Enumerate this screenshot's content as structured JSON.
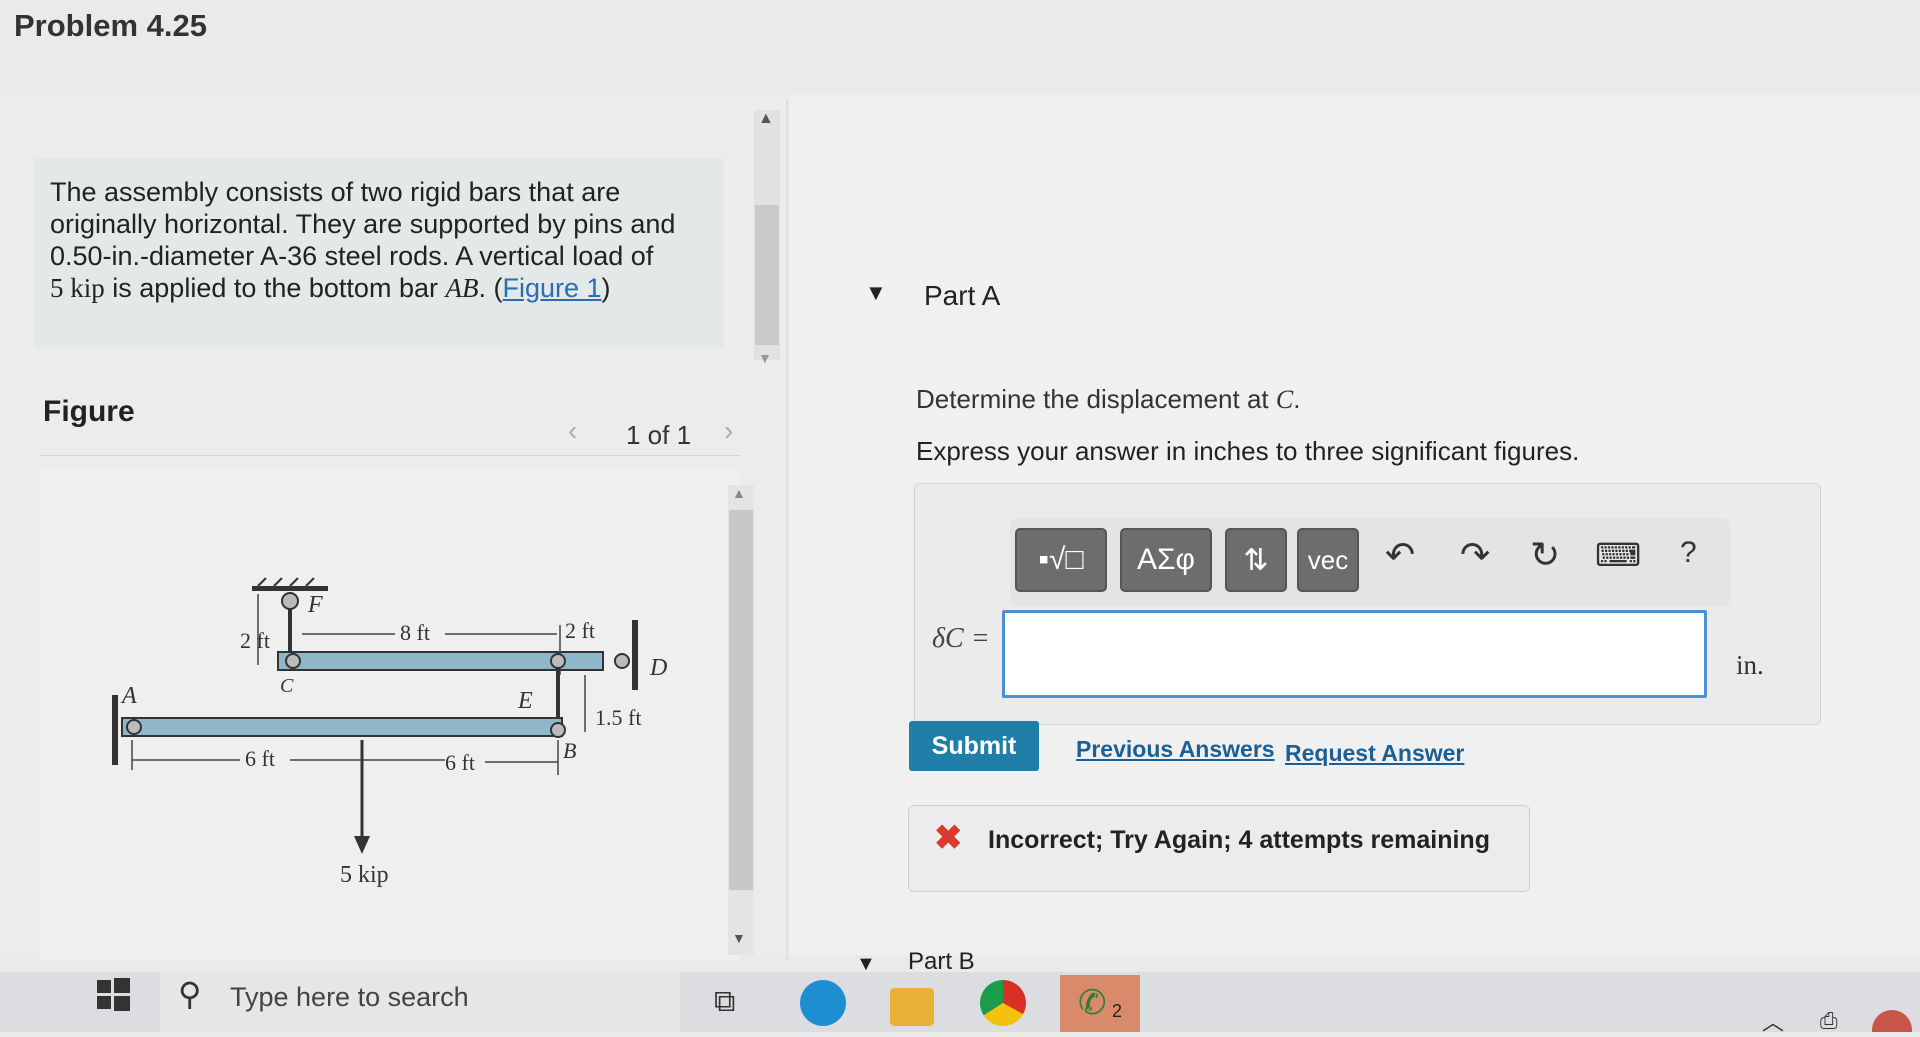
{
  "header": {
    "problem_title": "Problem 4.25"
  },
  "description": {
    "line1": "The assembly consists of two rigid bars that are",
    "line2": "originally horizontal. They are supported by pins and",
    "line3": "0.50-in.-diameter A-36 steel rods. A vertical load of",
    "line4_pre": "5 kip",
    "line4_mid": " is applied to the bottom bar ",
    "line4_math": "AB",
    "line4_post": ". (",
    "figure_link": "Figure 1",
    "line4_end": ")"
  },
  "figure": {
    "heading": "Figure",
    "pager": "1 of 1",
    "labels": {
      "A": "A",
      "B": "B",
      "C": "C",
      "D": "D",
      "E": "E",
      "F": "F",
      "dim_2ft_left": "2 ft",
      "dim_8ft": "8 ft",
      "dim_2ft_right": "2 ft",
      "dim_1_5ft": "1.5 ft",
      "dim_6ft_a": "6 ft",
      "dim_6ft_b": "6 ft",
      "load": "5 kip"
    }
  },
  "partA": {
    "title": "Part A",
    "question_pre": "Determine the displacement at ",
    "question_math": "C",
    "question_post": ".",
    "instruction": "Express your answer in inches to three significant figures.",
    "toolbar": {
      "greek_label": "ΑΣφ",
      "vec_label": "vec",
      "help_label": "?"
    },
    "answer_label": "δC =",
    "answer_value": "",
    "unit": "in.",
    "submit_label": "Submit",
    "previous_answers_label": "Previous Answers",
    "request_answer_label": "Request Answer",
    "feedback_text": "Incorrect; Try Again; 4 attempts remaining"
  },
  "partB": {
    "title": "Part B"
  },
  "taskbar": {
    "search_placeholder": "Type here to search",
    "whatsapp_badge": "2"
  },
  "colors": {
    "accent": "#1f7fa8",
    "link": "#1a5f95",
    "error": "#d83a2e",
    "input_border": "#4b8fd4",
    "bar_fill": "#8fb7c9"
  }
}
